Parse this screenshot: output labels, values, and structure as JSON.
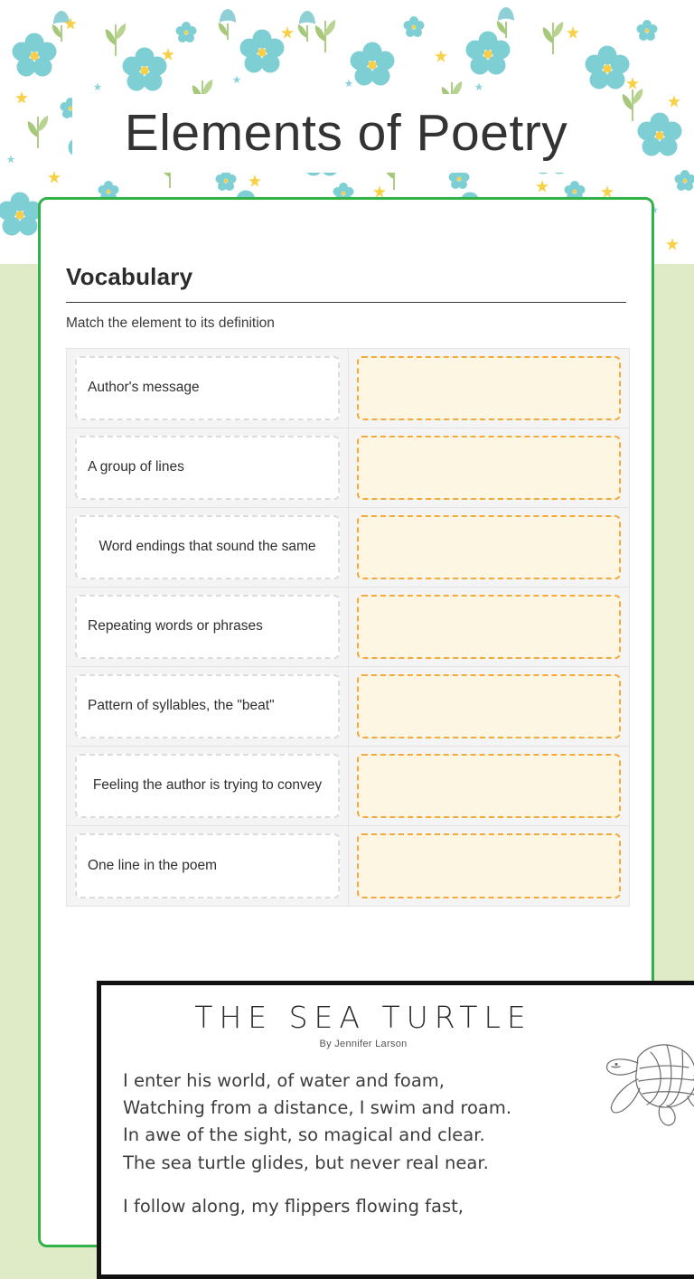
{
  "page": {
    "background_color": "#dfeac6",
    "card_border_color": "#32b34a"
  },
  "header": {
    "title": "Elements of Poetry",
    "banner_background": "#ffffff",
    "pattern_name": "teal-floral-pattern",
    "pattern_colors": {
      "flower": "#7ecfd4",
      "flower_center": "#f9cf4a",
      "leaf": "#a6c87a",
      "small_star": "#f7d046",
      "background": "#ffffff"
    }
  },
  "vocabulary": {
    "heading": "Vocabulary",
    "instruction": "Match the element to its definition",
    "drop_zone_fill": "#fdf6e3",
    "drop_zone_border": "#f5a93c",
    "term_border": "#dcdcdc",
    "rows": [
      {
        "definition": "Author's message",
        "multiline": false,
        "answer": ""
      },
      {
        "definition": "A group of lines",
        "multiline": false,
        "answer": ""
      },
      {
        "definition": "Word endings that sound the same",
        "multiline": true,
        "answer": ""
      },
      {
        "definition": "Repeating words or phrases",
        "multiline": false,
        "answer": ""
      },
      {
        "definition": "Pattern of syllables, the \"beat\"",
        "multiline": false,
        "answer": ""
      },
      {
        "definition": "Feeling the author is trying to convey",
        "multiline": true,
        "answer": ""
      },
      {
        "definition": "One line in the poem",
        "multiline": false,
        "answer": ""
      }
    ]
  },
  "poem": {
    "title": "THE SEA TURTLE",
    "byline": "By Jennifer Larson",
    "illustration": "sea-turtle-line-art",
    "stanzas": [
      [
        "I enter his world, of water and foam,",
        "Watching from a distance, I swim and roam.",
        "In awe of the sight, so magical and clear.",
        "The sea turtle glides, but never real near."
      ],
      [
        "I follow along, my flippers flowing fast,"
      ]
    ]
  }
}
